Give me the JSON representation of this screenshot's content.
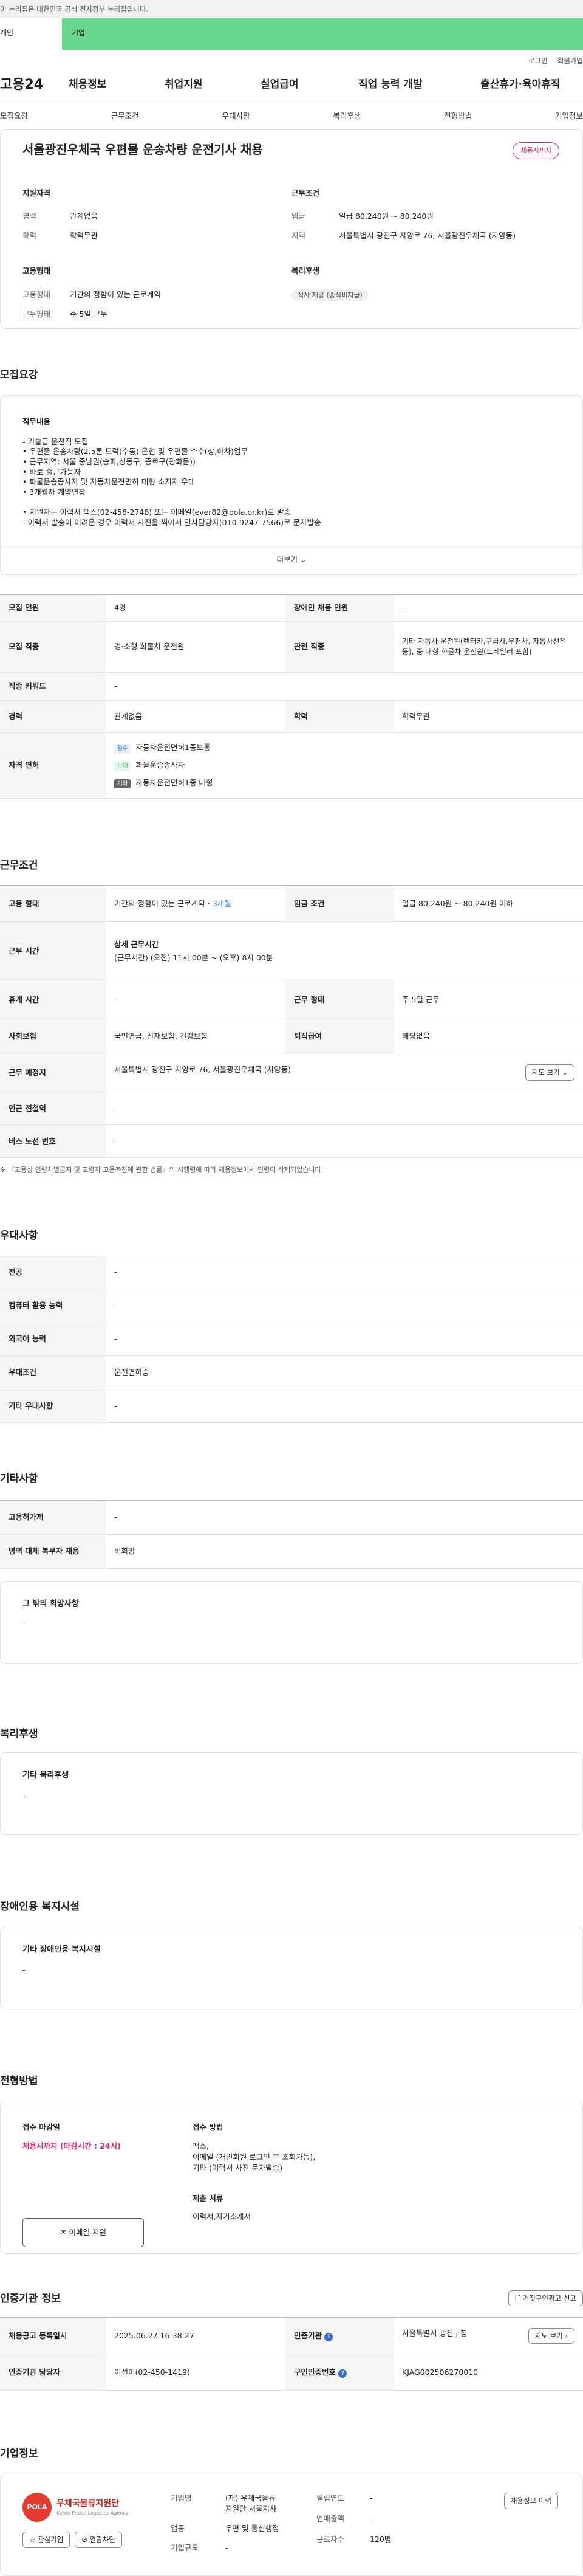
{
  "gov_bar": "이 누리집은 대한민국 공식 전자정부 누리집입니다.",
  "user_tabs": [
    "개인",
    "기업"
  ],
  "util": [
    "로그인",
    "회원가입"
  ],
  "logo": "고용24",
  "gnb": [
    "채용정보",
    "취업지원",
    "실업급여",
    "직업 능력 개발",
    "출산휴가·육아휴직"
  ],
  "jtabs": [
    "모집요강",
    "근무조건",
    "우대사항",
    "복리후생",
    "전형방법",
    "기업정보"
  ],
  "job_title": "서울광진우체국 우편물 운송차량 운전기사 채용",
  "deadline_badge": "채용시까지",
  "summary": {
    "qual": {
      "title": "지원자격",
      "rows": [
        {
          "k": "경력",
          "v": "관계없음"
        },
        {
          "k": "학력",
          "v": "학력무관"
        }
      ]
    },
    "cond": {
      "title": "근무조건",
      "rows": [
        {
          "k": "임금",
          "v": "일급 80,240원 ~ 80,240원"
        },
        {
          "k": "지역",
          "v": "서울특별시 광진구 자양로 76, 서울광진우체국 (자양동)"
        }
      ]
    },
    "emp": {
      "title": "고용형태",
      "rows": [
        {
          "k": "고용형태",
          "v": "기간의 정함이 있는 근로계약"
        },
        {
          "k": "근무형태",
          "v": "주 5일 근무"
        }
      ]
    },
    "welfare": {
      "title": "복리후생",
      "tag": "식사 제공 (중식비지급)"
    }
  },
  "recruit": {
    "title": "모집요강",
    "box_title": "직무내용",
    "lines": [
      "- 기술급 운전직 모집",
      "• 우편물 운송차량(2.5톤 트럭(수동) 운전 및 우편물 수수(상,하차)업무",
      "• 근무지역: 서울 중남권(송파,성동구, 종로구(광화문))",
      "• 바로 출근가능자",
      "• 화물운송종사자 및 자동차운전면허 대형 소지자 우대",
      "• 3개월차 계약연장",
      "",
      "• 지원자는 이력서 팩스(02-458-2748) 또는 이메일(ever82@pola.or.kr)로 발송",
      "- 이력서 발송이 어려운 경우 이력서 사진을 찍어서 인사담당자(010-9247-7566)로 문자발송"
    ],
    "more": "더보기",
    "t_count_k": "모집 인원",
    "t_count_v": "4명",
    "t_dis_k": "장애인 채용 인원",
    "t_dis_v": "-",
    "t_job_k": "모집 직종",
    "t_job_v": "경·소형 화물차 운전원",
    "t_rel_k": "관련 직종",
    "t_rel_v": "기타 자동차 운전원(렌터카,구급차,우편차, 자동차선적 등), 중·대형 화물차 운전원(트레일러 포함)",
    "t_kw_k": "직종 키워드",
    "t_kw_v": "-",
    "t_car_k": "경력",
    "t_car_v": "관계없음",
    "t_edu_k": "학력",
    "t_edu_v": "학력무관",
    "t_lic_k": "자격 면허",
    "licenses": [
      {
        "badge": "필수",
        "name": "자동차운전면허1종보통",
        "bg": "#e8f1fd",
        "fg": "#2b6fd6"
      },
      {
        "badge": "우대",
        "name": "화물운송종사자",
        "bg": "#e6f6ea",
        "fg": "#2e9b4e"
      },
      {
        "badge": "기타",
        "name": "자동차운전면허1종 대형",
        "bg": "#666666",
        "fg": "#ffffff"
      }
    ]
  },
  "work": {
    "title": "근무조건",
    "emp_k": "고용 형태",
    "emp_v": "기간의 정함이 있는 근로계약 · ",
    "emp_v2": "3개월",
    "wage_k": "임금 조건",
    "wage_v": "일급 80,240원 ~ 80,240원 이하",
    "time_k": "근무 시간",
    "time_h": "상세 근무시간",
    "time_v": "(근무시간) (오전) 11시 00분 ~ (오후) 8시 00분",
    "rest_k": "휴게 시간",
    "rest_v": "-",
    "form_k": "근무 형태",
    "form_v": "주 5일 근무",
    "ins_k": "사회보험",
    "ins_v": "국민연금, 산재보험, 건강보험",
    "sev_k": "퇴직급여",
    "sev_v": "해당없음",
    "place_k": "근무 예정지",
    "place_v": "서울특별시 광진구 자양로 76, 서울광진우체국 (자양동)",
    "map_btn": "지도 보기",
    "sub_k": "인근 전철역",
    "sub_v": "-",
    "bus_k": "버스 노선 번호",
    "bus_v": "-",
    "note": "※ 『고용상 연령차별금지 및 고령자 고용촉진에 관한 법률』의 시행령에 따라 채용정보에서 연령이 삭제되었습니다."
  },
  "pref": {
    "title": "우대사항",
    "rows": [
      {
        "k": "전공",
        "v": "-"
      },
      {
        "k": "컴퓨터 활용 능력",
        "v": "-"
      },
      {
        "k": "외국어 능력",
        "v": "-"
      },
      {
        "k": "우대조건",
        "v": "운전면허증"
      },
      {
        "k": "기타 우대사항",
        "v": "-"
      }
    ]
  },
  "etc": {
    "title": "기타사항",
    "rows": [
      {
        "k": "고용허가제",
        "v": "-"
      },
      {
        "k": "병역 대체 복무자 채용",
        "v": "비희망"
      }
    ],
    "box_h": "그 밖의 희망사항",
    "box_v": "-"
  },
  "welfare": {
    "title": "복리후생",
    "box_h": "기타 복리후생",
    "box_v": "-"
  },
  "disab": {
    "title": "장애인용 복지시설",
    "box_h": "기타 장애인용 복지시설",
    "box_v": "-"
  },
  "select": {
    "title": "전형방법",
    "deadline_h": "접수 마감일",
    "deadline_v": "채용시까지 (마감시간 : 24시)",
    "email_btn": "이메일 지원",
    "method_h": "접수 방법",
    "method_v": [
      "팩스,",
      "이메일 (개인회원 로그인 후 조회가능),",
      "기타 (이력서 사진 문자발송)"
    ],
    "docs_h": "제출 서류",
    "docs_v": "이력서,자기소개서"
  },
  "cert": {
    "title": "인증기관 정보",
    "badge_btn": "거짓구인광고 신고",
    "reg_k": "채용공고 등록일시",
    "reg_v": "2025.06.27 16:38:27",
    "org_k": "인증기관",
    "org_v": "서울특별시 광진구청",
    "map_btn": "지도 보기",
    "mgr_k": "인증기관 담당자",
    "mgr_v": "이선미(02-450-1419)",
    "no_k": "구인인증번호",
    "no_v": "KJAG002506270010"
  },
  "company": {
    "title": "기업정보",
    "logo_text": "우체국물류지원단",
    "logo_sub": "Korea Postal Logistics Agency",
    "logo_circle": "POLA",
    "fav_btn": "관심기업",
    "block_btn": "열람차단",
    "name_k": "기업명",
    "name_v": [
      "(재) 우체국물류",
      "지원단 서울지사"
    ],
    "ind_k": "업종",
    "ind_v": "우편 및 통신행정",
    "size_k": "기업규모",
    "size_v": "-",
    "year_k": "설립연도",
    "year_v": "-",
    "sales_k": "연매출액",
    "sales_v": "-",
    "emp_k": "근로자수",
    "emp_v": "120명",
    "hist_btn": "채용정보 이력"
  }
}
